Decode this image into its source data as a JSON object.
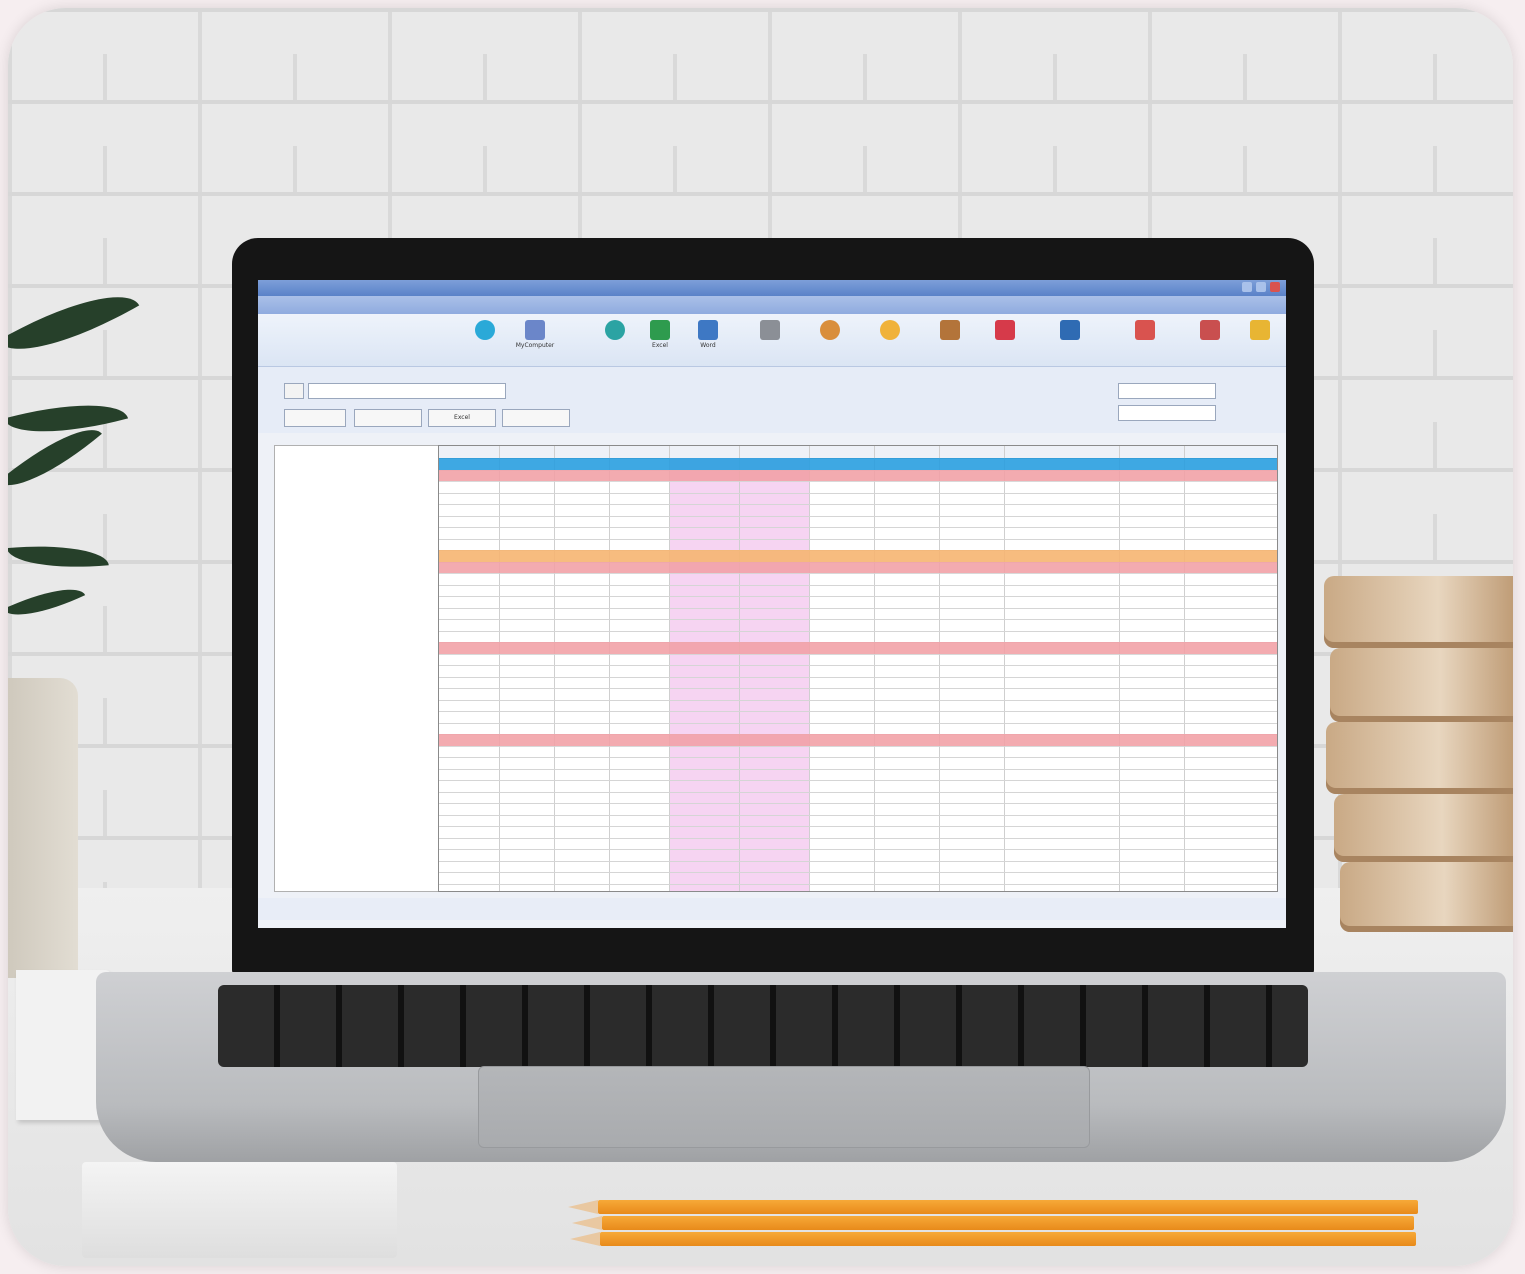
{
  "app": {
    "toolbar_labels": [
      "Excel",
      "Word",
      "MyComputer"
    ],
    "filter": {
      "export_button": "Excel"
    }
  },
  "colors": {
    "selected_row": "#2a9fe0",
    "holiday_row": "#f2a2a8",
    "thursday_row": "#f7b572",
    "highlight_column": "#f4cdf0"
  },
  "icons": [
    "calendar-icon",
    "computer-icon",
    "refresh-icon",
    "excel-icon",
    "word-icon",
    "calculator-icon",
    "help-icon",
    "grid-icon",
    "globe-icon",
    "folder-icon"
  ]
}
